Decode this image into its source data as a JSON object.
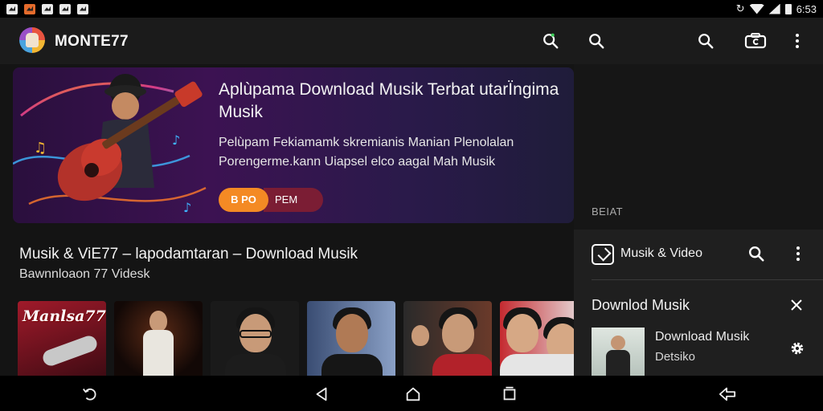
{
  "status_bar": {
    "time": "6:53",
    "icons": [
      "gallery-icon",
      "app-icon",
      "image-icon",
      "image-icon",
      "photo-icon"
    ],
    "right_icons": [
      "sync-icon",
      "wifi-icon",
      "signal-icon",
      "battery-icon"
    ]
  },
  "app_bar": {
    "title": "MONTE77",
    "actions": [
      "refresh-search-icon",
      "search-icon",
      "search-icon",
      "cast-icon",
      "more-vert-icon"
    ]
  },
  "hero": {
    "title": "Aplùpama Download Musik Terbat utarÏngima Musik",
    "description": "Pelùpam Fekiamamk skremianis Manian Plenolalan Porengerme.kann Uiapsel elco aagal Mah Musik",
    "primary_button": "B PO",
    "secondary_button": "PEM",
    "accent": "#f48a24",
    "secondary_accent": "#7b1d34"
  },
  "section": {
    "title": "Musik & ViE77 – lapodamtaran – Download Musik",
    "subtitle": "Bawnnloaon 77 Videsk"
  },
  "thumbnails": [
    {
      "label": "Manlsa77",
      "bg": "#7a1222"
    },
    {
      "label": "",
      "bg": "#24120c"
    },
    {
      "label": "",
      "bg": "#1a1a1a"
    },
    {
      "label": "",
      "bg": "#4b5f86"
    },
    {
      "label": "",
      "bg": "#3b1f18"
    },
    {
      "label": "",
      "bg": "#b8232c"
    }
  ],
  "right_panel": {
    "section_label": "BEIAT",
    "card_title": "Musik & Video",
    "download_title": "Downlod Musik",
    "item_title": "Download Musik",
    "item_subtitle": "Detsiko"
  },
  "nav_bar": {
    "buttons": [
      "back-icon",
      "back-triangle-icon",
      "home-icon",
      "recents-icon",
      "pin-icon"
    ]
  }
}
